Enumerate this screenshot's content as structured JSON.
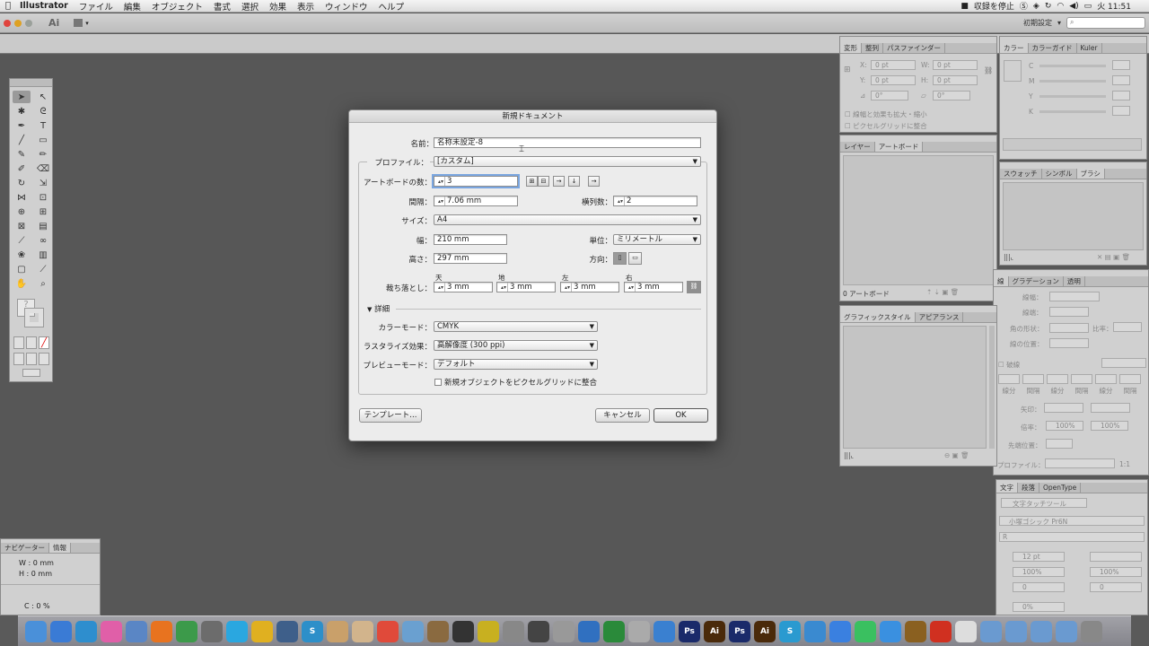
{
  "menubar": {
    "apple": "",
    "app_name": "Illustrator",
    "items": [
      "ファイル",
      "編集",
      "オブジェクト",
      "書式",
      "選択",
      "効果",
      "表示",
      "ウィンドウ",
      "ヘルプ"
    ],
    "recording": "収録を停止",
    "clock": "火 11:51"
  },
  "controlbar": {
    "app_logo": "Ai",
    "workspace": "初期設定",
    "search_placeholder": ""
  },
  "dialog": {
    "title": "新規ドキュメント",
    "name_label": "名前：",
    "name_value": "名称未設定-8",
    "profile_label": "プロファイル：",
    "profile_value": "[カスタム]",
    "artboards_label": "アートボードの数：",
    "artboards_value": "3",
    "spacing_label": "間隔：",
    "spacing_value": "7.06 mm",
    "columns_label": "横列数：",
    "columns_value": "2",
    "size_label": "サイズ：",
    "size_value": "A4",
    "width_label": "幅：",
    "width_value": "210 mm",
    "units_label": "単位：",
    "units_value": "ミリメートル",
    "height_label": "高さ：",
    "height_value": "297 mm",
    "orientation_label": "方向：",
    "bleed_label": "裁ち落とし：",
    "bleed_top_label": "天",
    "bleed_bottom_label": "地",
    "bleed_left_label": "左",
    "bleed_right_label": "右",
    "bleed_top": "3 mm",
    "bleed_bottom": "3 mm",
    "bleed_left": "3 mm",
    "bleed_right": "3 mm",
    "advanced_label": "詳細",
    "color_mode_label": "カラーモード：",
    "color_mode_value": "CMYK",
    "raster_label": "ラスタライズ効果：",
    "raster_value": "高解像度 (300 ppi)",
    "preview_label": "プレビューモード：",
    "preview_value": "デフォルト",
    "pixel_grid_label": "新規オブジェクトをピクセルグリッドに整合",
    "pixel_grid_checked": false,
    "templates_button": "テンプレート...",
    "cancel_button": "キャンセル",
    "ok_button": "OK"
  },
  "panels": {
    "transform": {
      "tabs": [
        "変形",
        "整列",
        "パスファインダー"
      ],
      "x_label": "X:",
      "x_value": "0 pt",
      "y_label": "Y:",
      "y_value": "0 pt",
      "w_label": "W:",
      "w_value": "0 pt",
      "h_label": "H:",
      "h_value": "0 pt",
      "angle_value": "0°",
      "shear_value": "0°",
      "scale_strokes": "線幅と効果も拡大・縮小",
      "align_pixel": "ピクセルグリッドに整合"
    },
    "color": {
      "tabs": [
        "カラー",
        "カラーガイド",
        "Kuler"
      ],
      "channels": [
        "C",
        "M",
        "Y",
        "K"
      ]
    },
    "layers": {
      "tabs": [
        "レイヤー",
        "アートボード"
      ],
      "footer": "0 アートボード"
    },
    "swatches": {
      "tabs": [
        "スウォッチ",
        "シンボル",
        "ブラシ"
      ]
    },
    "stroke": {
      "tabs": [
        "線",
        "グラデーション",
        "透明"
      ],
      "weight": "線幅：",
      "cap": "線端：",
      "corner": "角の形状：",
      "ratio": "比率：",
      "align": "線の位置：",
      "dashed": "破線",
      "dash_labels": [
        "線分",
        "間隔",
        "線分",
        "間隔",
        "線分",
        "間隔"
      ],
      "arrow": "矢印：",
      "scale": "倍率：",
      "scale_values": [
        "100%",
        "100%"
      ],
      "tip": "先端位置：",
      "profile": "プロファイル：",
      "profile_value": "1:1"
    },
    "graphic_styles": {
      "tabs": [
        "グラフィックスタイル",
        "アピアランス"
      ]
    },
    "character": {
      "tabs": [
        "文字",
        "段落",
        "OpenType"
      ],
      "touch_tool": "文字タッチツール",
      "font": "小塚ゴシック Pr6N",
      "style": "R",
      "size": "12 pt",
      "scale_h": "100%",
      "scale_v": "100%",
      "tracking": "0",
      "kerning": "0",
      "shift": "0%"
    },
    "navigator": {
      "tabs": [
        "ナビゲーター",
        "情報"
      ],
      "w_label": "W : 0 mm",
      "h_label": "H : 0 mm",
      "c_label": "C : 0 %"
    }
  },
  "dock": {
    "apps": [
      "Finder",
      "App Store",
      "Safari",
      "Mail",
      "Preview",
      "Firefox",
      "Chrome",
      "Calculator",
      "Skype",
      "Adium",
      "Home",
      "S",
      "Notes",
      "Books",
      "Calendar",
      "Network",
      "Photo",
      "Clapper",
      "Star",
      "Camera",
      "Time Machine",
      "Utility",
      "QuickTime",
      "Leaf",
      "Keyboard",
      "Xcode",
      "Ps",
      "Ai",
      "Ps",
      "Ai",
      "S",
      "Safari",
      "Dropbox",
      "LINE",
      "Messenger",
      "Game",
      "Acrobat",
      "Doc",
      "Folder",
      "Folder",
      "Folder",
      "Folder",
      "Trash"
    ]
  },
  "colors": {
    "canvas": "#575757",
    "panel": "#d0d0d0",
    "dialog": "#ececec",
    "focus": "#7aa6e0"
  }
}
